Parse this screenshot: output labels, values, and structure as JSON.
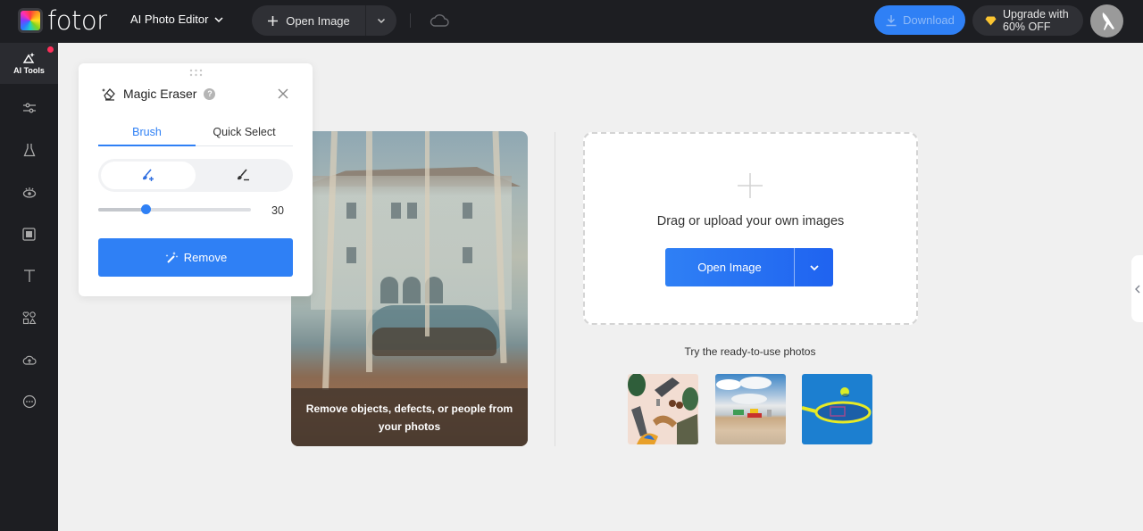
{
  "header": {
    "brand": "fotor",
    "editor_menu": "AI Photo Editor",
    "open_image": "Open Image",
    "download": "Download",
    "upgrade_line1": "Upgrade with",
    "upgrade_line2": "60% OFF",
    "icons": [
      "logo-icon",
      "chevron-down-icon",
      "plus-icon",
      "chevron-down-icon",
      "cloud-icon",
      "download-icon",
      "diamond-icon",
      "avatar-bird-icon"
    ]
  },
  "sidebar": {
    "items": [
      {
        "label": "AI Tools",
        "icon": "ai-tools-icon",
        "active": true,
        "badge": true
      },
      {
        "label": "",
        "icon": "adjust-sliders-icon"
      },
      {
        "label": "",
        "icon": "beaker-icon"
      },
      {
        "label": "",
        "icon": "eye-icon"
      },
      {
        "label": "",
        "icon": "frame-icon"
      },
      {
        "label": "",
        "icon": "text-icon"
      },
      {
        "label": "",
        "icon": "elements-icon"
      },
      {
        "label": "",
        "icon": "cloud-upload-icon"
      },
      {
        "label": "",
        "icon": "more-icon"
      }
    ]
  },
  "panel": {
    "title": "Magic Eraser",
    "help": "?",
    "tabs": [
      {
        "label": "Brush",
        "active": true
      },
      {
        "label": "Quick Select",
        "active": false
      }
    ],
    "modes": [
      {
        "name": "brush-add",
        "active": true
      },
      {
        "name": "brush-erase",
        "active": false
      }
    ],
    "brush_size": 30,
    "brush_size_label": "30",
    "brush_size_fraction": 0.31,
    "remove_label": "Remove"
  },
  "preview": {
    "caption": "Remove objects, defects, or people from your photos"
  },
  "upload": {
    "hint": "Drag or upload your own images",
    "button": "Open Image",
    "try_label": "Try the ready-to-use photos",
    "samples": [
      "fashion-flatlay",
      "desert-road-sign",
      "tennis-racket-ball"
    ]
  },
  "colors": {
    "accent": "#2f80f5",
    "topbar": "#1d1e22",
    "badge": "#ff2f5a",
    "canvas": "#f0f0f0"
  }
}
